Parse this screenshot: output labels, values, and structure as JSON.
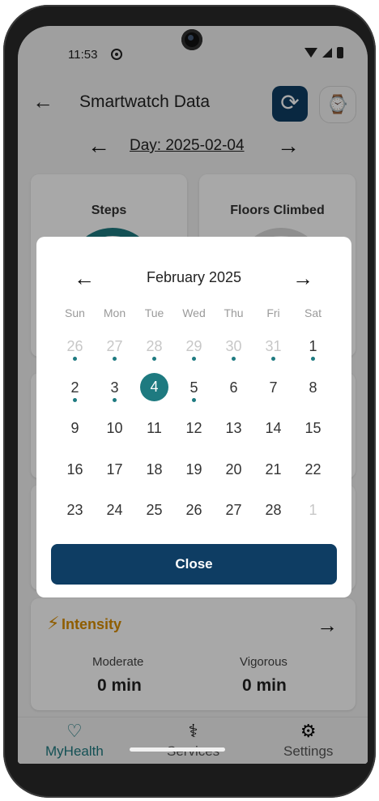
{
  "status_bar": {
    "time": "11:53"
  },
  "header": {
    "title": "Smartwatch Data",
    "back_icon": "←",
    "sync_icon": "⟳",
    "watch_icon": "⌚"
  },
  "day_nav": {
    "label": "Day: 2025-02-04",
    "prev": "←",
    "next": "→"
  },
  "cards": {
    "steps": "Steps",
    "floors": "Floors Climbed",
    "intensity": {
      "title": "Intensity",
      "icon": "⚡",
      "moderate_label": "Moderate",
      "moderate_value": "0 min",
      "vigorous_label": "Vigorous",
      "vigorous_value": "0 min",
      "arrow": "→"
    }
  },
  "bottom_nav": [
    {
      "label": "MyHealth",
      "icon": "♡",
      "active": true
    },
    {
      "label": "Services",
      "icon": "⚕",
      "active": false
    },
    {
      "label": "Settings",
      "icon": "⚙",
      "active": false
    }
  ],
  "calendar": {
    "month_label": "February 2025",
    "prev": "←",
    "next": "→",
    "weekdays": [
      "Sun",
      "Mon",
      "Tue",
      "Wed",
      "Thu",
      "Fri",
      "Sat"
    ],
    "weeks": [
      [
        {
          "d": "26",
          "m": true,
          "dot": true
        },
        {
          "d": "27",
          "m": true,
          "dot": true
        },
        {
          "d": "28",
          "m": true,
          "dot": true
        },
        {
          "d": "29",
          "m": true,
          "dot": true
        },
        {
          "d": "30",
          "m": true,
          "dot": true
        },
        {
          "d": "31",
          "m": true,
          "dot": true
        },
        {
          "d": "1",
          "m": false,
          "dot": true
        }
      ],
      [
        {
          "d": "2",
          "m": false,
          "dot": true
        },
        {
          "d": "3",
          "m": false,
          "dot": true
        },
        {
          "d": "4",
          "m": false,
          "dot": false,
          "sel": true
        },
        {
          "d": "5",
          "m": false,
          "dot": true
        },
        {
          "d": "6",
          "m": false,
          "dot": false
        },
        {
          "d": "7",
          "m": false,
          "dot": false
        },
        {
          "d": "8",
          "m": false,
          "dot": false
        }
      ],
      [
        {
          "d": "9"
        },
        {
          "d": "10"
        },
        {
          "d": "11"
        },
        {
          "d": "12"
        },
        {
          "d": "13"
        },
        {
          "d": "14"
        },
        {
          "d": "15"
        }
      ],
      [
        {
          "d": "16"
        },
        {
          "d": "17"
        },
        {
          "d": "18"
        },
        {
          "d": "19"
        },
        {
          "d": "20"
        },
        {
          "d": "21"
        },
        {
          "d": "22"
        }
      ],
      [
        {
          "d": "23"
        },
        {
          "d": "24"
        },
        {
          "d": "25"
        },
        {
          "d": "26"
        },
        {
          "d": "27"
        },
        {
          "d": "28"
        },
        {
          "d": "1",
          "m": true
        }
      ]
    ],
    "close_label": "Close"
  },
  "colors": {
    "primary": "#0e3d63",
    "teal": "#1e7a80",
    "amber": "#d98d00"
  }
}
